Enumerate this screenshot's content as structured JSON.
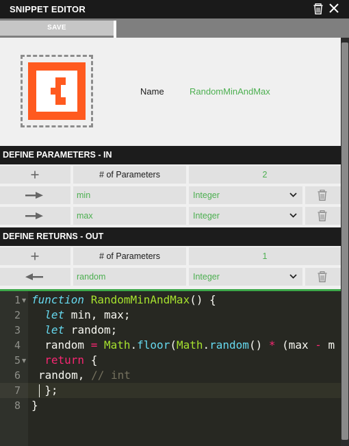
{
  "window": {
    "title": "SNIPPET EDITOR"
  },
  "toolbar": {
    "save_label": "SAVE"
  },
  "snippet": {
    "name_label": "Name",
    "name_value": "RandomMinAndMax"
  },
  "params_in": {
    "header": "DEFINE PARAMETERS - IN",
    "count_label": "# of Parameters",
    "count": "2",
    "rows": [
      {
        "name": "min",
        "type": "Integer"
      },
      {
        "name": "max",
        "type": "Integer"
      }
    ]
  },
  "returns_out": {
    "header": "DEFINE RETURNS - OUT",
    "count_label": "# of Parameters",
    "count": "1",
    "rows": [
      {
        "name": "random",
        "type": "Integer"
      }
    ]
  },
  "code": {
    "line_numbers": [
      "1",
      "2",
      "3",
      "4",
      "5",
      "6",
      "7",
      "8"
    ],
    "tokens": {
      "l1_kw": "function",
      "l1_fn": "RandomMinAndMax",
      "l1_rest": "() {",
      "l2_kw": "let",
      "l2_rest": " min, max;",
      "l3_kw": "let",
      "l3_rest": " random;",
      "l4_a": "random ",
      "l4_eq": "=",
      "l4_sp": " ",
      "l4_math1": "Math",
      "l4_dot1": ".",
      "l4_floor": "floor",
      "l4_paren": "(",
      "l4_math2": "Math",
      "l4_dot2": ".",
      "l4_random": "random",
      "l4_call": "() ",
      "l4_star": "*",
      "l4_tail": " (max ",
      "l4_minus": "-",
      "l4_m": " m",
      "l5_kw": "return",
      "l5_rest": " {",
      "l6_a": "random, ",
      "l6_cm": "// int",
      "l7": "};",
      "l8": "}"
    }
  },
  "colors": {
    "accent_green": "#4caf50",
    "editor_bg": "#272822",
    "header_bg": "#1c1c1c"
  },
  "icons": [
    "trash-icon",
    "close-icon",
    "add-icon",
    "arrow-right-icon",
    "arrow-left-icon",
    "chevron-down-icon",
    "app-logo"
  ]
}
